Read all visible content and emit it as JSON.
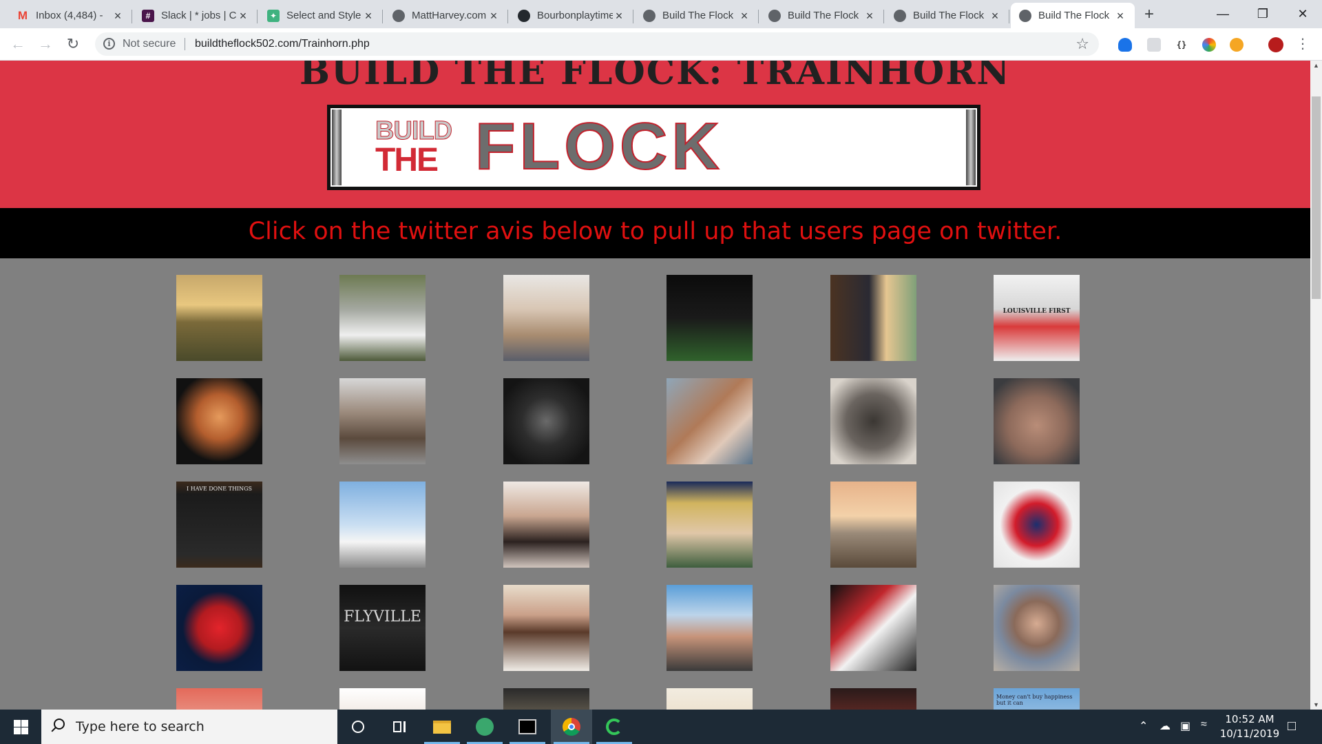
{
  "browser": {
    "tabs": [
      {
        "title": "Inbox (4,484) - ",
        "icon": "gmail-icon",
        "color": "#ea4335"
      },
      {
        "title": "Slack | * jobs | C",
        "icon": "slack-icon",
        "color": "#4a154b"
      },
      {
        "title": "Select and Style",
        "icon": "codepen-icon",
        "color": "#3fb27f"
      },
      {
        "title": "MattHarvey.com",
        "icon": "globe-icon",
        "color": "#5f6368"
      },
      {
        "title": "Bourbonplaytime",
        "icon": "github-icon",
        "color": "#24292e"
      },
      {
        "title": "Build The Flock",
        "icon": "globe-icon",
        "color": "#5f6368"
      },
      {
        "title": "Build The Flock",
        "icon": "globe-icon",
        "color": "#5f6368"
      },
      {
        "title": "Build The Flock",
        "icon": "globe-icon",
        "color": "#5f6368"
      },
      {
        "title": "Build The Flock",
        "icon": "globe-icon",
        "color": "#5f6368",
        "active": true
      }
    ],
    "security_label": "Not secure",
    "url": "buildtheflock502.com/Trainhorn.php"
  },
  "page": {
    "title": "BUILD THE FLOCK: TRAINHORN",
    "logo": {
      "line1": "BUILD",
      "line2": "THE",
      "word": "FLOCK"
    },
    "instruction": "Click on the twitter avis below to pull up that users page on twitter.",
    "colors": {
      "banner": "#dc3545",
      "instruction_text": "#e01010",
      "background": "#808080"
    },
    "avatars": [
      {
        "alt": "horse at sunset",
        "bg": "linear-gradient(180deg,#c7a86b 0%,#e8c77f 35%,#7b6a3a 55%,#4a4a2a 100%)"
      },
      {
        "alt": "family photo",
        "bg": "linear-gradient(180deg,#6d7a52 0%,#a4a8a0 40%,#efefef 70%,#4e5a3a 100%)"
      },
      {
        "alt": "young man selfie",
        "bg": "linear-gradient(180deg,#e9e7e4 0%,#d8c6b4 40%,#a88c70 70%,#5a5e6a 100%)"
      },
      {
        "alt": "football field night",
        "bg": "linear-gradient(180deg,#0b0b0b 0%,#1a1a1a 50%,#30622c 100%)"
      },
      {
        "alt": "couple photo",
        "bg": "linear-gradient(90deg,#4b3322 0%,#2a2a33 45%,#e6c691 65%,#7fa079 100%)"
      },
      {
        "alt": "cardinal mascot",
        "bg": "linear-gradient(180deg,#f2f2f2 0%,#d6d6d6 40%,#d93a3a 60%,#eeeeee 100%)",
        "text": "LOUISVILLE FIRST",
        "text_color": "#222"
      },
      {
        "alt": "bearded man portrait",
        "bg": "radial-gradient(circle at 50% 45%,#e59a5c 0%,#b45e2e 35%,#111 70%)"
      },
      {
        "alt": "man in car",
        "bg": "linear-gradient(180deg,#d7d7d7 0%,#9b8a7c 40%,#5b4a3d 70%,#8e8e8e 100%)"
      },
      {
        "alt": "man sitting at night",
        "bg": "radial-gradient(circle at 50% 50%,#6a6a6a 0%,#2d2d2d 40%,#141414 80%)"
      },
      {
        "alt": "father with baby",
        "bg": "linear-gradient(135deg,#8fa6b8 0%,#b07a58 45%,#e0c9b9 70%,#59738a 100%)"
      },
      {
        "alt": "dog portrait",
        "bg": "radial-gradient(circle at 50% 50%,#3b3733 0%,#6b6560 45%,#d9d3cb 85%)"
      },
      {
        "alt": "older man selfie",
        "bg": "radial-gradient(circle at 50% 55%,#b98d78 0%,#8d6a5b 45%,#3b3c3f 85%)"
      },
      {
        "alt": "soldier creed plaque",
        "bg": "linear-gradient(180deg,#3b2a1c 0%,#1b1b1b 15%,#2a2a2a 85%,#3b2a1c 100%)",
        "text": "I HAVE DONE THINGS",
        "text_color": "#e8e8e8"
      },
      {
        "alt": "bridge and sky",
        "bg": "linear-gradient(180deg,#7fb0e0 0%,#c9def2 50%,#f5f5f5 70%,#8a8a8a 100%)"
      },
      {
        "alt": "man in bed",
        "bg": "linear-gradient(180deg,#efe9e4 0%,#c9a690 40%,#2c2220 70%,#d0c4bd 100%)"
      },
      {
        "alt": "couple at game",
        "bg": "linear-gradient(180deg,#1a2a5a 0%,#d1b45e 25%,#e0c7a8 60%,#3e5e3e 100%)"
      },
      {
        "alt": "family at beach sunset",
        "bg": "linear-gradient(180deg,#e7b38a 0%,#f3d1a9 40%,#9a8a79 60%,#5a4a3a 100%)"
      },
      {
        "alt": "patriotic cardinal logo",
        "bg": "radial-gradient(circle at 50% 50%,#1b2f6e 0%,#d21c2b 35%,#f1f1f1 60%,#e4e4e4 100%)"
      },
      {
        "alt": "cardinal bird logo",
        "bg": "radial-gradient(circle at 50% 50%,#e3242b 0%,#b31b20 35%,#0a1a3a 60%,#0b1e44 100%)"
      },
      {
        "alt": "flyville poster",
        "bg": "linear-gradient(180deg,#101010 0%,#2a2a2a 50%,#121212 100%)",
        "text": "FLYVILLE",
        "text_color": "#d8d8d8"
      },
      {
        "alt": "woman drinking",
        "bg": "linear-gradient(180deg,#e8dccb 0%,#caa089 35%,#5a3a2a 55%,#f0ece6 100%)"
      },
      {
        "alt": "friends tailgate",
        "bg": "linear-gradient(180deg,#5a9ed8 0%,#bcd4ea 35%,#c7947a 60%,#3a3a3a 100%)"
      },
      {
        "alt": "football team collage",
        "bg": "linear-gradient(135deg,#111 0%,#c1272d 35%,#f2f2f2 55%,#222 100%)"
      },
      {
        "alt": "smiling man",
        "bg": "radial-gradient(circle at 50% 45%,#d6ab92 0%,#8a6a5a 35%,#7b8aa0 60%,#b9b0a5 100%)"
      },
      {
        "alt": "partial avatar row 5 col 1",
        "bg": "linear-gradient(180deg,#e46a5a 0%,#f1e2d8 100%)"
      },
      {
        "alt": "partial avatar row 5 col 2",
        "bg": "linear-gradient(180deg,#ffffff 0%,#d2b8a6 100%)"
      },
      {
        "alt": "partial avatar row 5 col 3",
        "bg": "linear-gradient(180deg,#2a2a2a 0%,#d9c39a 100%)"
      },
      {
        "alt": "partial avatar row 5 col 4",
        "bg": "linear-gradient(180deg,#f2ece0 0%,#e0c9a6 100%)"
      },
      {
        "alt": "partial avatar row 5 col 5",
        "bg": "linear-gradient(180deg,#2a1a1a 0%,#d04a3a 100%)"
      },
      {
        "alt": "partial avatar row 5 col 6",
        "bg": "linear-gradient(180deg,#6aa4d8 0%,#e8f1f8 100%)",
        "text": "Money can't buy happiness but it can",
        "text_color": "#223"
      }
    ]
  },
  "taskbar": {
    "search_placeholder": "Type here to search",
    "time": "10:52 AM",
    "date": "10/11/2019"
  }
}
